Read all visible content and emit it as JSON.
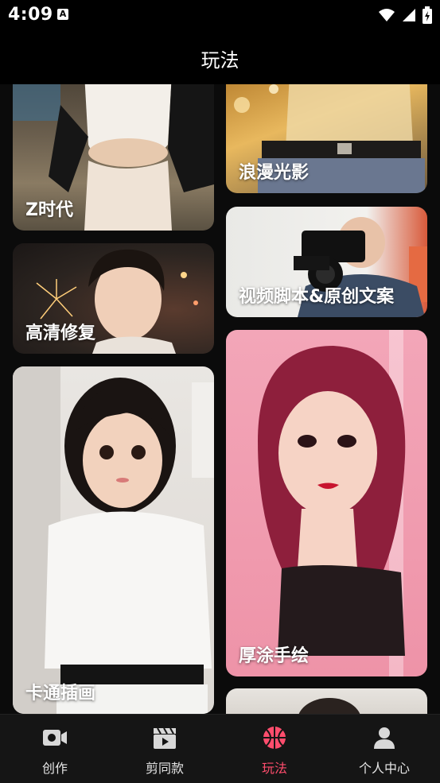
{
  "status": {
    "time": "4:09",
    "notification_glyph": "A"
  },
  "header": {
    "title": "玩法"
  },
  "cards": [
    {
      "label": "Z时代"
    },
    {
      "label": "浪漫光影"
    },
    {
      "label": "视频脚本&原创文案"
    },
    {
      "label": "高清修复"
    },
    {
      "label": "卡通插画"
    },
    {
      "label": "厚涂手绘"
    }
  ],
  "nav": [
    {
      "label": "创作",
      "icon": "video-camera-icon"
    },
    {
      "label": "剪同款",
      "icon": "clapper-icon"
    },
    {
      "label": "玩法",
      "icon": "basketball-icon",
      "active": true
    },
    {
      "label": "个人中心",
      "icon": "user-icon"
    }
  ],
  "colors": {
    "accent": "#ff4d6d",
    "background": "#0b0b0b",
    "nav_bg": "#151515"
  }
}
